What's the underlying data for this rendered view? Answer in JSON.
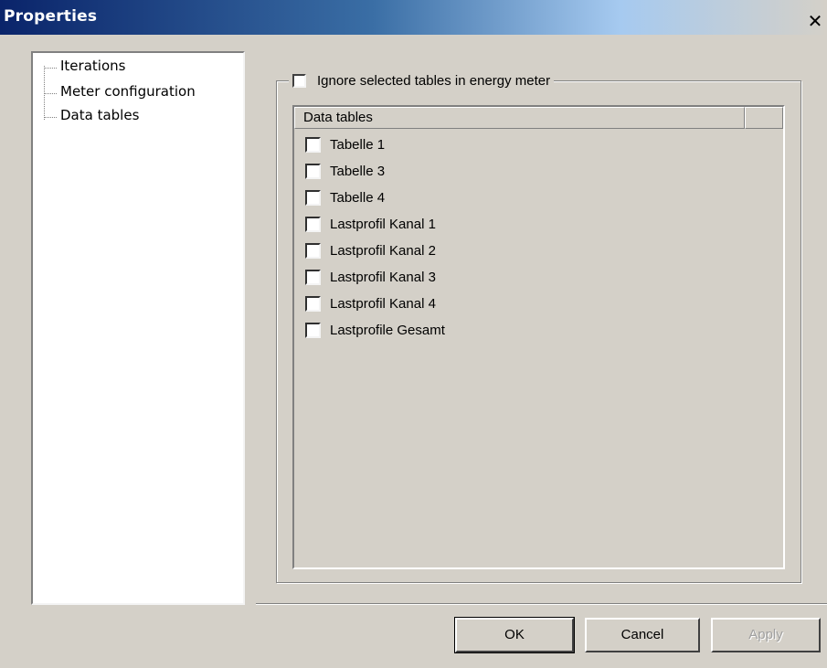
{
  "window": {
    "title": "Properties",
    "close_glyph": "✕"
  },
  "tree": {
    "items": [
      {
        "label": "Iterations"
      },
      {
        "label": "Meter configuration"
      },
      {
        "label": "Data tables",
        "selected": true
      }
    ]
  },
  "group": {
    "checkbox_label": "Ignore selected tables in energy meter",
    "checked": false
  },
  "list": {
    "header": "Data tables",
    "rows": [
      {
        "label": "Tabelle 1",
        "checked": false
      },
      {
        "label": "Tabelle 3",
        "checked": false
      },
      {
        "label": "Tabelle 4",
        "checked": false
      },
      {
        "label": "Lastprofil Kanal 1",
        "checked": false
      },
      {
        "label": "Lastprofil Kanal 2",
        "checked": false
      },
      {
        "label": "Lastprofil Kanal 3",
        "checked": false
      },
      {
        "label": "Lastprofil Kanal 4",
        "checked": false
      },
      {
        "label": "Lastprofile Gesamt",
        "checked": false
      }
    ]
  },
  "buttons": {
    "ok": "OK",
    "cancel": "Cancel",
    "apply": "Apply"
  },
  "icons": {
    "close": "close-icon",
    "checkbox": "checkbox-unchecked"
  }
}
